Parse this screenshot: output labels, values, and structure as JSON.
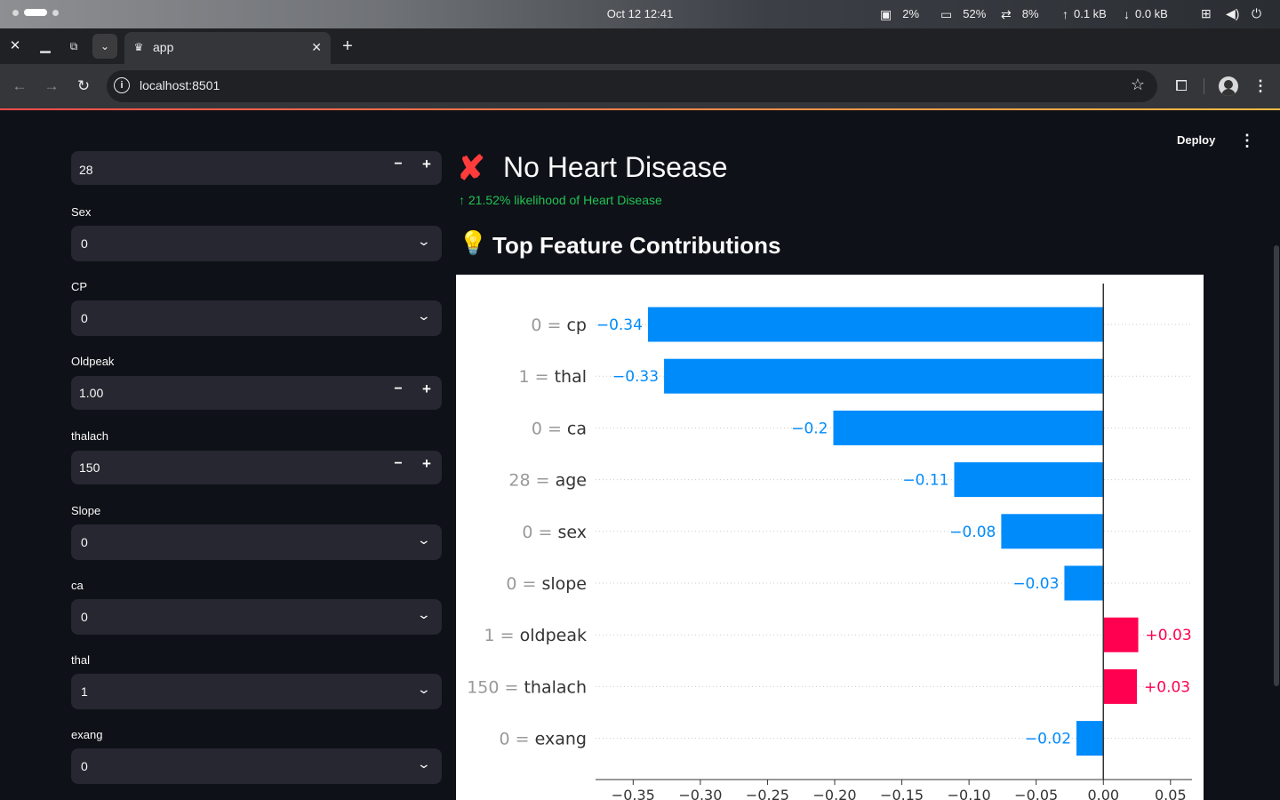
{
  "os": {
    "clock": "Oct 12  12:41",
    "cpu": "2%",
    "memory": "52%",
    "swap": "8%",
    "upload": "0.1 kB",
    "download": "0.0 kB",
    "icons": [
      "cpu-icon",
      "memory-icon",
      "swap-icon",
      "network-icon",
      "volume-icon",
      "power-icon"
    ]
  },
  "browser": {
    "tab_title": "app",
    "url": "localhost:8501"
  },
  "header": {
    "deploy_label": "Deploy"
  },
  "sidebar": {
    "age_value": "28",
    "sex_label": "Sex",
    "sex_value": "0",
    "cp_label": "CP",
    "cp_value": "0",
    "oldpeak_label": "Oldpeak",
    "oldpeak_value": "1.00",
    "thalach_label": "thalach",
    "thalach_value": "150",
    "slope_label": "Slope",
    "slope_value": "0",
    "ca_label": "ca",
    "ca_value": "0",
    "thal_label": "thal",
    "thal_value": "1",
    "exang_label": "exang",
    "exang_value": "0"
  },
  "main": {
    "result_title": "No Heart Disease",
    "result_delta": "21.52% likelihood of Heart Disease",
    "section_title": "Top Feature Contributions"
  },
  "chart_data": {
    "type": "bar",
    "orientation": "horizontal",
    "categories": [
      "0 = cp",
      "1 = thal",
      "0 = ca",
      "28 = age",
      "0 = sex",
      "0 = slope",
      "1 = oldpeak",
      "150 = thalach",
      "0 = exang"
    ],
    "feature_values": [
      "0",
      "1",
      "0",
      "28",
      "0",
      "0",
      "1",
      "150",
      "0"
    ],
    "feature_names": [
      "cp",
      "thal",
      "ca",
      "age",
      "sex",
      "slope",
      "oldpeak",
      "thalach",
      "exang"
    ],
    "values": [
      -0.34,
      -0.33,
      -0.2,
      -0.11,
      -0.08,
      -0.03,
      0.03,
      0.03,
      -0.02
    ],
    "value_labels": [
      "−0.34",
      "−0.33",
      "−0.2",
      "−0.11",
      "−0.08",
      "−0.03",
      "+0.03",
      "+0.03",
      "−0.02"
    ],
    "bar_values": [
      -0.339,
      -0.327,
      -0.201,
      -0.111,
      -0.076,
      -0.029,
      0.026,
      0.025,
      -0.02
    ],
    "xlim": [
      -0.378,
      0.066
    ],
    "xticks": [
      -0.35,
      -0.3,
      -0.25,
      -0.2,
      -0.15,
      -0.1,
      -0.05,
      0.0,
      0.05
    ],
    "xtick_labels": [
      "−0.35",
      "−0.30",
      "−0.25",
      "−0.20",
      "−0.15",
      "−0.10",
      "−0.05",
      "0.00",
      "0.05"
    ],
    "colors": {
      "negative": "#008bfb",
      "positive": "#ff0051"
    },
    "grid": "dotted horizontal row lines"
  }
}
